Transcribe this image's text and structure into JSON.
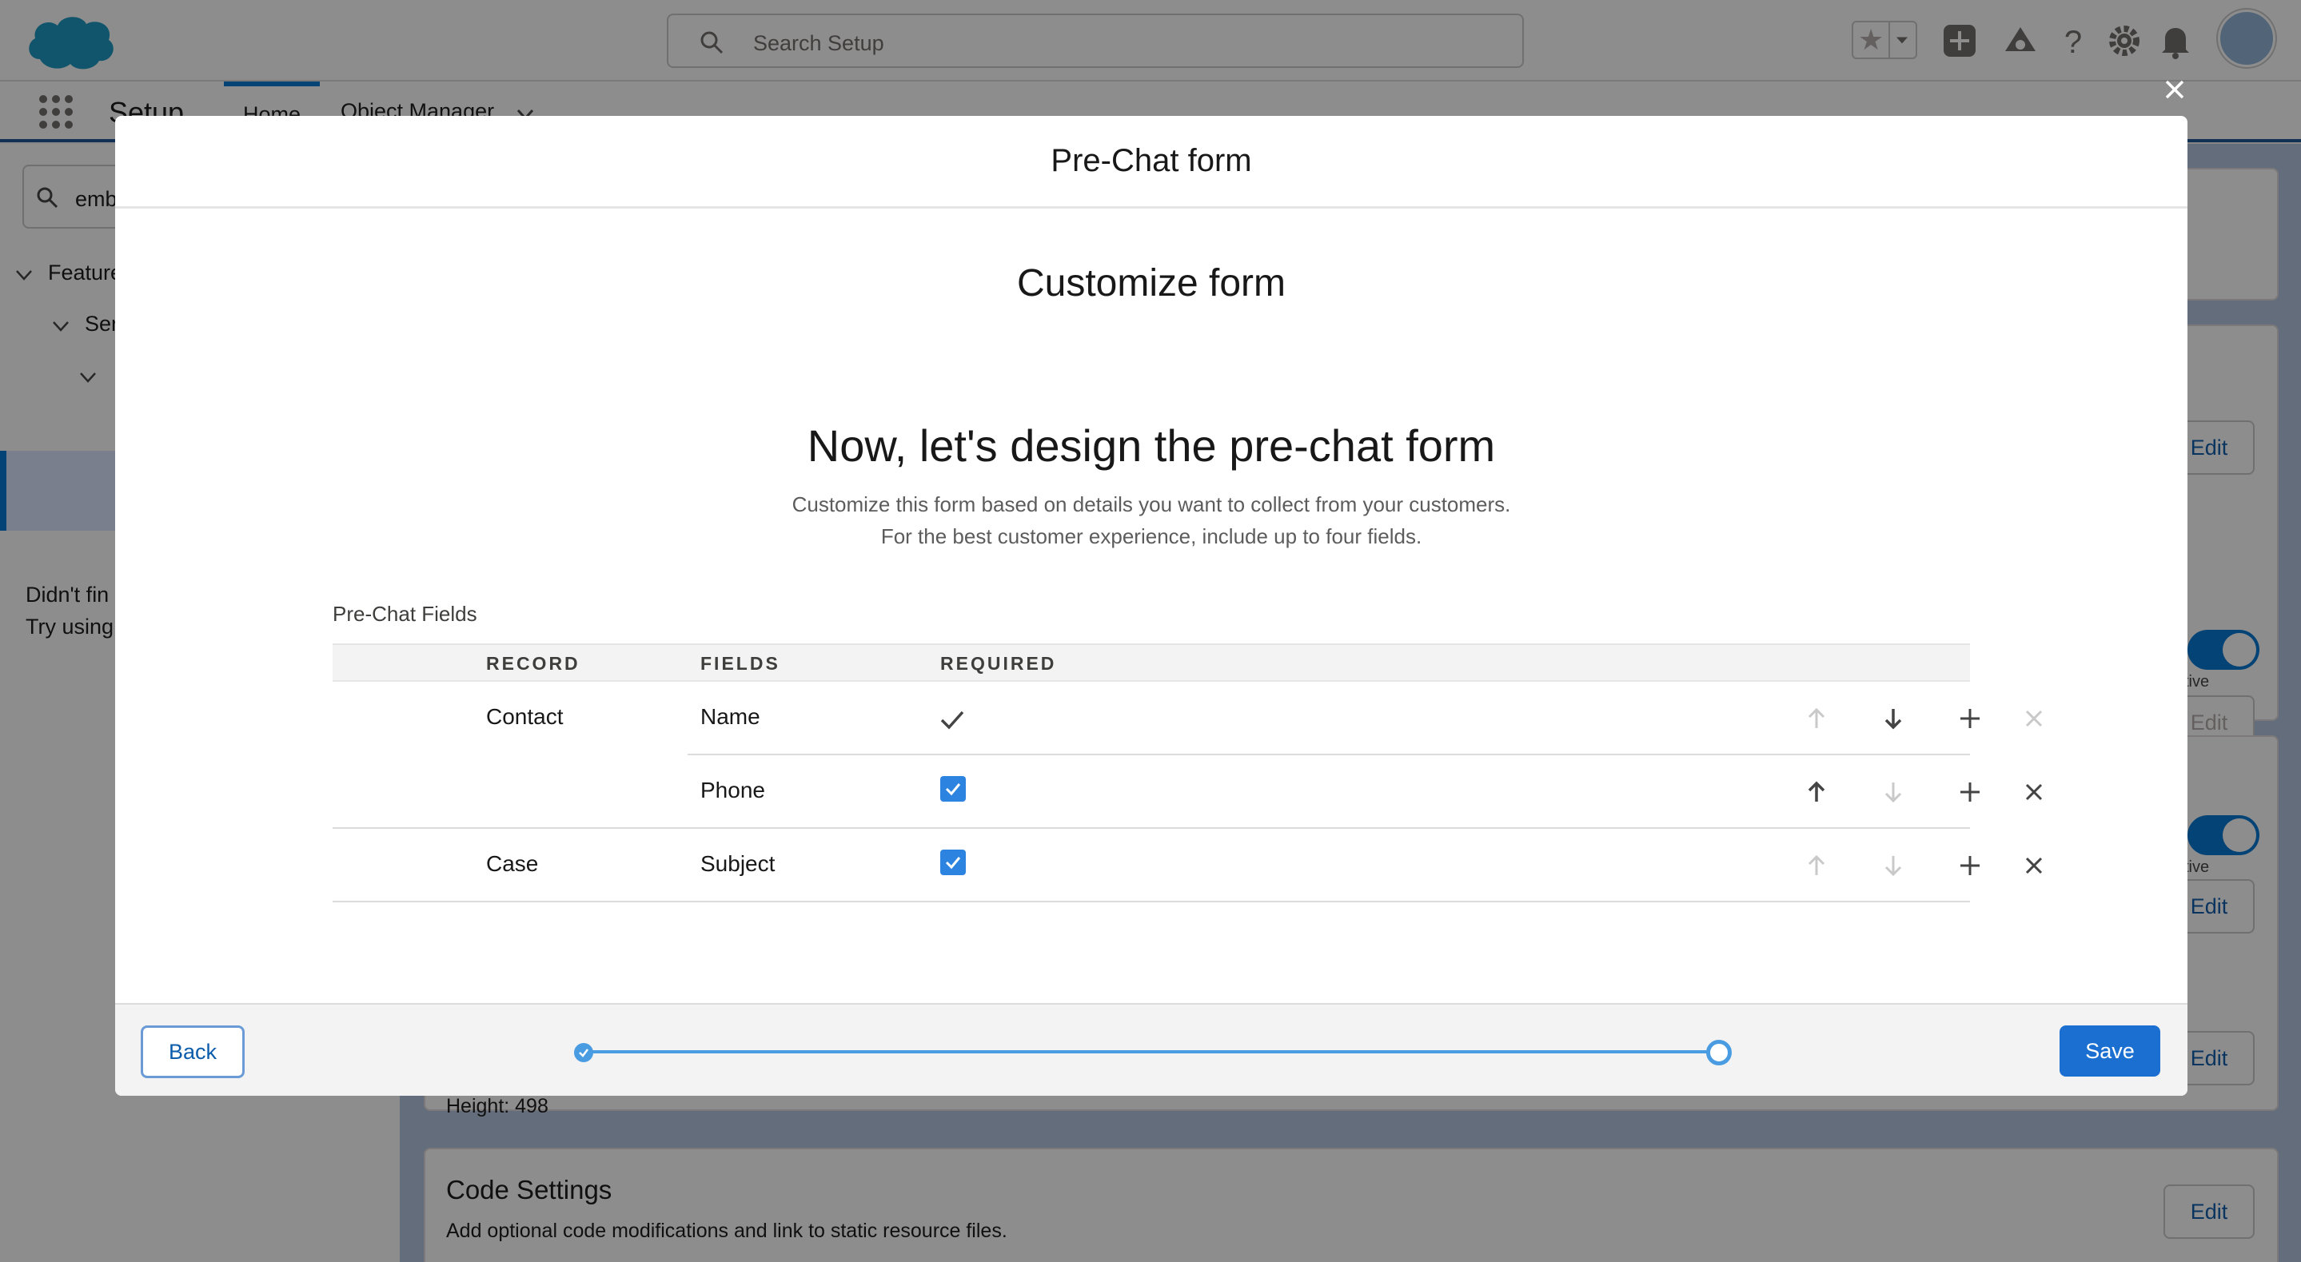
{
  "setup": {
    "search_placeholder": "Search Setup",
    "app_name": "Setup",
    "tabs": {
      "home": "Home",
      "object_manager": "Object Manager"
    },
    "quick_find_value": "emb",
    "tree": {
      "item1": "Feature",
      "item2": "Ser"
    },
    "help_line1": "Didn't fin",
    "help_line2": "Try using",
    "bg": {
      "edit": "Edit",
      "toggle_label": "tive",
      "height_text": "Height: 498",
      "code_settings_title": "Code Settings",
      "code_settings_desc": "Add optional code modifications and link to static resource files."
    }
  },
  "modal": {
    "title": "Pre-Chat form",
    "step_title": "Customize form",
    "heading": "Now, let's design the pre-chat form",
    "desc_line1": "Customize this form based on details you want to collect from your customers.",
    "desc_line2": "For the best customer experience, include up to four fields.",
    "fields_label": "Pre-Chat Fields",
    "columns": {
      "record": "RECORD",
      "fields": "FIELDS",
      "required": "REQUIRED"
    },
    "rows": [
      {
        "record": "Contact",
        "field": "Name",
        "required": true,
        "locked": true
      },
      {
        "record": "",
        "field": "Phone",
        "required": true,
        "locked": false
      },
      {
        "record": "Case",
        "field": "Subject",
        "required": true,
        "locked": false
      }
    ],
    "footer": {
      "back": "Back",
      "save": "Save",
      "progress_percent": 100
    }
  },
  "colors": {
    "brand_blue": "#1b6fd1",
    "progress": "#4a9ce2",
    "checkbox": "#2d84e0"
  }
}
